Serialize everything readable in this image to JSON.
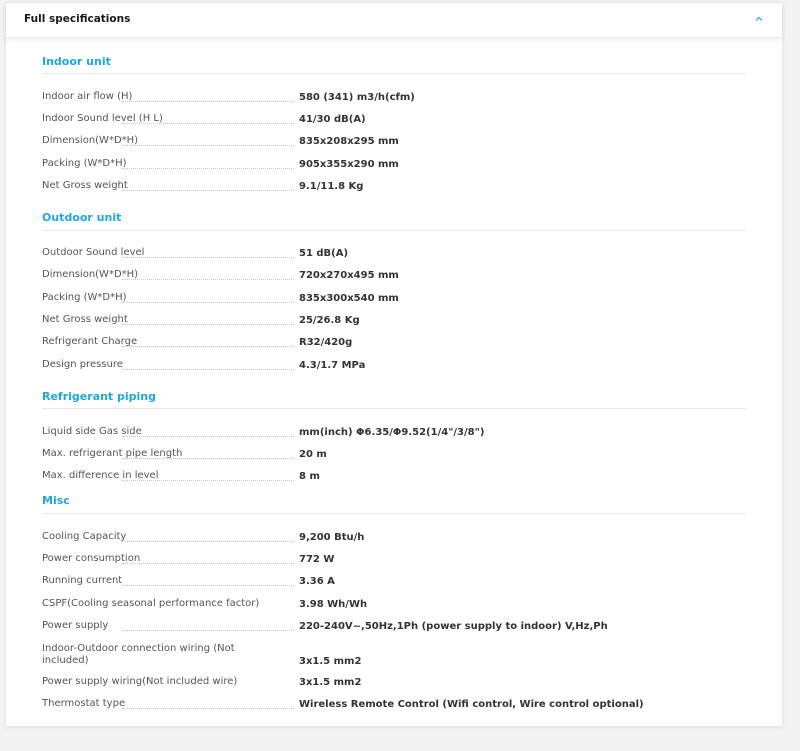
{
  "header": {
    "title": "Full specifications",
    "toggle_icon": "chevron-up-icon"
  },
  "sections": [
    {
      "title": "Indoor unit",
      "rows": [
        {
          "label": "Indoor air flow (H)",
          "value": "580 (341) m3/h(cfm)"
        },
        {
          "label": "Indoor Sound level (H L)",
          "value": "41/30 dB(A)"
        },
        {
          "label": "Dimension(W*D*H)",
          "value": "835x208x295 mm"
        },
        {
          "label": "Packing (W*D*H)",
          "value": "905x355x290 mm"
        },
        {
          "label": "Net Gross weight",
          "value": "9.1/11.8 Kg"
        }
      ]
    },
    {
      "title": "Outdoor unit",
      "rows": [
        {
          "label": "Outdoor Sound level",
          "value": "51 dB(A)"
        },
        {
          "label": "Dimension(W*D*H)",
          "value": "720x270x495 mm"
        },
        {
          "label": "Packing (W*D*H)",
          "value": "835x300x540 mm"
        },
        {
          "label": "Net Gross weight",
          "value": "25/26.8 Kg"
        },
        {
          "label": "Refrigerant Charge",
          "value": "R32/420g"
        },
        {
          "label": "Design pressure",
          "value": "4.3/1.7 MPa"
        }
      ]
    },
    {
      "title": "Refrigerant piping",
      "rows": [
        {
          "label": "Liquid side Gas side",
          "value": "mm(inch) Φ6.35/Φ9.52(1/4\"/3/8\")"
        },
        {
          "label": "Max. refrigerant pipe length",
          "value": "20 m"
        },
        {
          "label": "Max. difference in level",
          "value": "8 m"
        }
      ]
    },
    {
      "title": "Misc",
      "rows": [
        {
          "label": "Cooling Capacity",
          "value": "9,200 Btu/h"
        },
        {
          "label": "Power consumption",
          "value": "772 W"
        },
        {
          "label": "Running current",
          "value": "3.36 A"
        },
        {
          "label": "CSPF(Cooling seasonal performance factor)",
          "value": "3.98 Wh/Wh"
        },
        {
          "label": "Power supply",
          "value": "220-240V~,50Hz,1Ph (power supply to indoor) V,Hz,Ph"
        },
        {
          "label": "Indoor-Outdoor connection wiring (Not included)",
          "value": "3x1.5 mm2"
        },
        {
          "label": "Power supply wiring(Not included wire)",
          "value": "3x1.5 mm2"
        },
        {
          "label": "Thermostat type",
          "value": "Wireless Remote Control (Wifi control, Wire control optional)"
        }
      ]
    }
  ]
}
